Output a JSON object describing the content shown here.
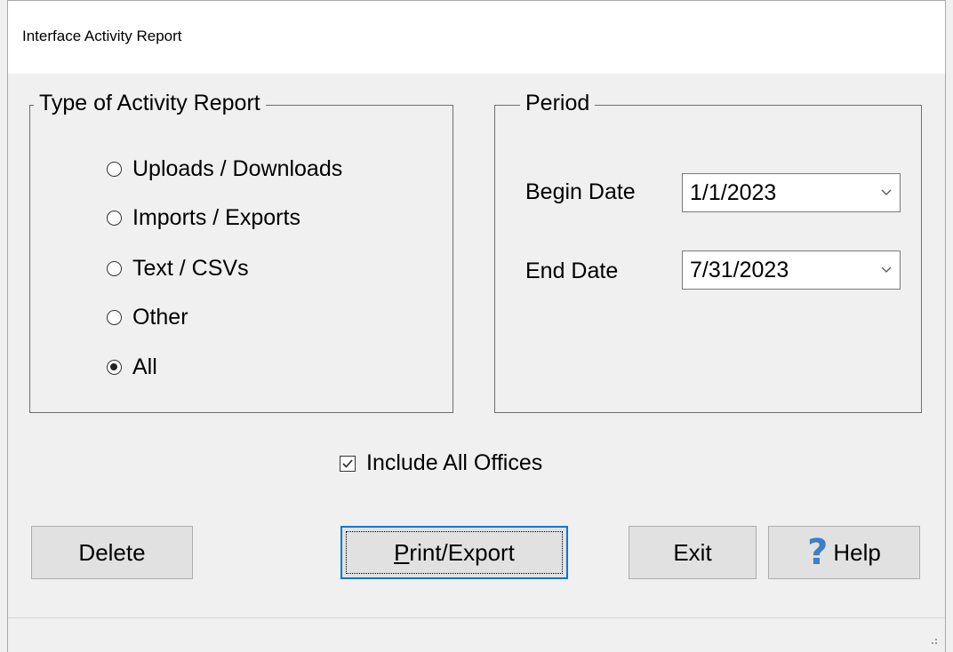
{
  "window": {
    "title": "Interface Activity Report"
  },
  "activity_group": {
    "legend": "Type of Activity Report",
    "options": [
      {
        "label": "Uploads / Downloads",
        "checked": false
      },
      {
        "label": "Imports / Exports",
        "checked": false
      },
      {
        "label": "Text / CSVs",
        "checked": false
      },
      {
        "label": "Other",
        "checked": false
      },
      {
        "label": "All",
        "checked": true
      }
    ]
  },
  "period_group": {
    "legend": "Period",
    "begin_label": "Begin Date",
    "begin_value": "1/1/2023",
    "end_label": "End Date",
    "end_value": "7/31/2023"
  },
  "include_all_offices": {
    "label": "Include All Offices",
    "checked": true
  },
  "buttons": {
    "delete": "Delete",
    "print_export_first": "P",
    "print_export_rest": "rint/Export",
    "exit": "Exit",
    "help": "Help"
  },
  "colors": {
    "accent": "#0078d7",
    "help_icon": "#3c7fc7"
  }
}
